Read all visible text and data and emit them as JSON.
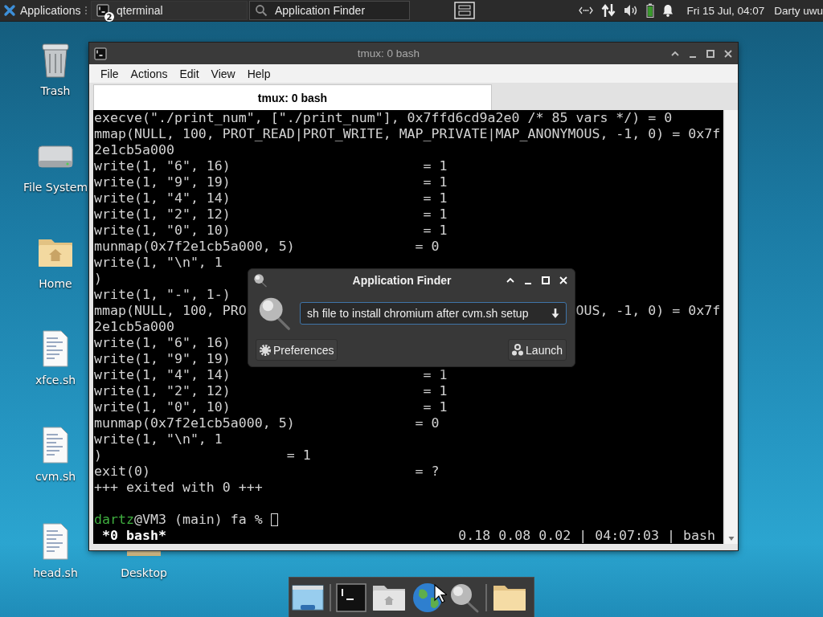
{
  "panel": {
    "menu": "Applications",
    "tasks": [
      {
        "label": "qterminal",
        "kind": "terminal",
        "badge": "2",
        "selected": false
      },
      {
        "label": "Application Finder",
        "kind": "search",
        "selected": true
      }
    ],
    "clock": "Fri 15 Jul, 04:07",
    "user": "Darty uwu"
  },
  "desktop": {
    "columns": [
      [
        {
          "label": "Trash",
          "kind": "trash"
        },
        {
          "label": "File System",
          "kind": "drive"
        },
        {
          "label": "Home",
          "kind": "home"
        },
        {
          "label": "xfce.sh",
          "kind": "file"
        },
        {
          "label": "cvm.sh",
          "kind": "file"
        },
        {
          "label": "head.sh",
          "kind": "file"
        }
      ],
      [
        {
          "label": "Desktop",
          "kind": "folder"
        }
      ]
    ]
  },
  "terminal_window": {
    "title": "tmux: 0 bash",
    "menu": [
      "File",
      "Actions",
      "Edit",
      "View",
      "Help"
    ],
    "tabs": [
      {
        "label": "tmux: 0 bash",
        "selected": true
      }
    ],
    "lines": [
      {
        "parts": [
          "execve(\"./print_num\", [\"./print_num\"], 0x7ffd6cd9a2e0 /* 85 vars */) = 0"
        ]
      },
      {
        "parts": [
          "mmap(NULL, 100, PROT_READ|PROT_WRITE, MAP_PRIVATE|MAP_ANONYMOUS, -1, 0) = 0x7f"
        ]
      },
      {
        "parts": [
          "2e1cb5a000"
        ]
      },
      {
        "parts": [
          "write(1, \"6\", 16)",
          "                        = 1"
        ]
      },
      {
        "parts": [
          "write(1, \"9\", 19)",
          "                        = 1"
        ]
      },
      {
        "parts": [
          "write(1, \"4\", 14)",
          "                        = 1"
        ]
      },
      {
        "parts": [
          "write(1, \"2\", 12)",
          "                        = 1"
        ]
      },
      {
        "parts": [
          "write(1, \"0\", 10)",
          "                        = 1"
        ]
      },
      {
        "parts": [
          "munmap(0x7f2e1cb5a000, 5)",
          "               = 0"
        ]
      },
      {
        "parts": [
          "write(1, \"\\n\", 1"
        ]
      },
      {
        "parts": [
          ")"
        ]
      },
      {
        "parts": [
          "write(1, \"-\", 1-)"
        ]
      },
      {
        "parts": [
          "mmap(NULL, 100, PRO",
          "                                         OUS, -1, 0) = 0x7f"
        ]
      },
      {
        "parts": [
          "2e1cb5a000"
        ]
      },
      {
        "parts": [
          "write(1, \"6\", 16)"
        ]
      },
      {
        "parts": [
          "write(1, \"9\", 19)"
        ]
      },
      {
        "parts": [
          "write(1, \"4\", 14)",
          "                        = 1"
        ]
      },
      {
        "parts": [
          "write(1, \"2\", 12)",
          "                        = 1"
        ]
      },
      {
        "parts": [
          "write(1, \"0\", 10)",
          "                        = 1"
        ]
      },
      {
        "parts": [
          "munmap(0x7f2e1cb5a000, 5)",
          "               = 0"
        ]
      },
      {
        "parts": [
          "write(1, \"\\n\", 1"
        ]
      },
      {
        "parts": [
          ")",
          "                       = 1"
        ]
      },
      {
        "parts": [
          "exit(0)",
          "                                 = ?"
        ]
      },
      {
        "parts": [
          "+++ exited with 0 +++"
        ]
      }
    ],
    "prompt": {
      "user": "dartz",
      "rest": "@VM3 (main) fa %"
    },
    "status": {
      "left": "*0 bash*",
      "right": "0.18 0.08 0.02 | 04:07:03 | bash"
    }
  },
  "app_finder": {
    "title": "Application Finder",
    "query": "sh file to install chromium after cvm.sh setup",
    "buttons": [
      {
        "label": "Preferences",
        "kind": "gear"
      },
      {
        "label": "Launch",
        "kind": "gears"
      }
    ]
  },
  "dock": [
    {
      "kind": "window"
    },
    {
      "kind": "separator"
    },
    {
      "kind": "terminal"
    },
    {
      "kind": "home"
    },
    {
      "kind": "globe"
    },
    {
      "kind": "search"
    },
    {
      "kind": "separator"
    },
    {
      "kind": "folder"
    }
  ]
}
